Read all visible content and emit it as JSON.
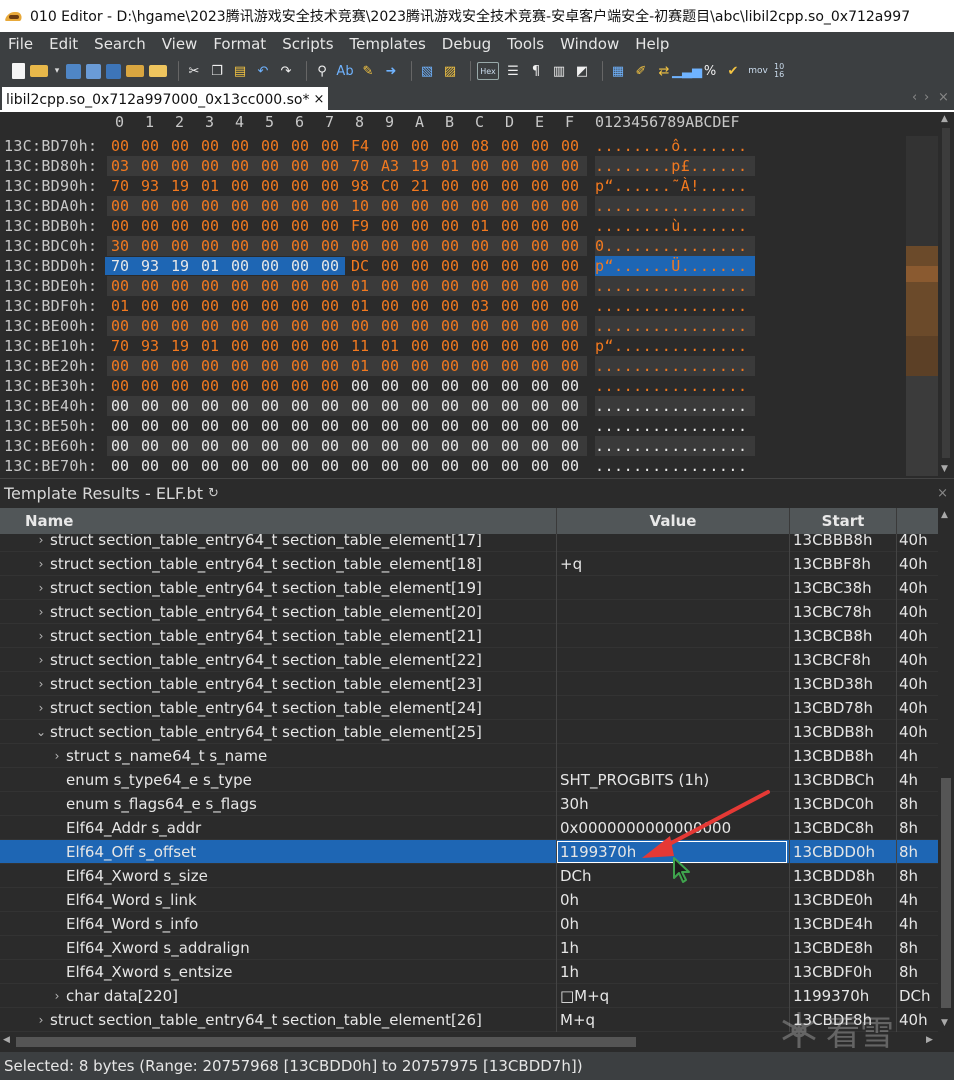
{
  "window": {
    "title": "010 Editor - D:\\hgame\\2023腾讯游戏安全技术竞赛\\2023腾讯游戏安全技术竞赛-安卓客户端安全-初赛题目\\abc\\libil2cpp.so_0x712a997"
  },
  "menu": [
    "File",
    "Edit",
    "Search",
    "View",
    "Format",
    "Scripts",
    "Templates",
    "Debug",
    "Tools",
    "Window",
    "Help"
  ],
  "toolbar": {
    "icons": [
      "new-file-icon",
      "open-folder-icon",
      "save-icon",
      "save-as-icon",
      "save-all-icon",
      "close-icon",
      "open-all-icon",
      "cut-icon",
      "copy-icon",
      "paste-icon",
      "undo-icon",
      "redo-icon",
      "find-icon",
      "replace-icon",
      "find-in-files-icon",
      "goto-icon",
      "compare-icon",
      "script-icon",
      "hex-mode-icon",
      "columns-icon",
      "paragraph-icon",
      "list-icon",
      "highlight-icon",
      "calculator-icon",
      "bookmark-icon",
      "swap-icon",
      "histogram-icon",
      "percent-icon",
      "check-icon",
      "mov-icon",
      "base-icon"
    ],
    "hex_label": "Hex",
    "mov_label": "mov",
    "base_label": "10 16"
  },
  "tab": {
    "label": "libil2cpp.so_0x712a997000_0x13cc000.so*",
    "close": "×",
    "nav_left": "‹",
    "nav_right": "›",
    "nav_close": "×"
  },
  "hex": {
    "column_headers": [
      "0",
      "1",
      "2",
      "3",
      "4",
      "5",
      "6",
      "7",
      "8",
      "9",
      "A",
      "B",
      "C",
      "D",
      "E",
      "F"
    ],
    "ascii_header": "0123456789ABCDEF",
    "rows": [
      {
        "addr": "13C:BD70h:",
        "bytes": [
          "00",
          "00",
          "00",
          "00",
          "00",
          "00",
          "00",
          "00",
          "F4",
          "00",
          "00",
          "00",
          "08",
          "00",
          "00",
          "00"
        ],
        "ascii": "........ô.......",
        "color_until": 16
      },
      {
        "addr": "13C:BD80h:",
        "bytes": [
          "03",
          "00",
          "00",
          "00",
          "00",
          "00",
          "00",
          "00",
          "70",
          "A3",
          "19",
          "01",
          "00",
          "00",
          "00",
          "00"
        ],
        "ascii": "........p£......",
        "color_until": 16
      },
      {
        "addr": "13C:BD90h:",
        "bytes": [
          "70",
          "93",
          "19",
          "01",
          "00",
          "00",
          "00",
          "00",
          "98",
          "C0",
          "21",
          "00",
          "00",
          "00",
          "00",
          "00"
        ],
        "ascii": "p“......˜À!.....",
        "color_until": 16
      },
      {
        "addr": "13C:BDA0h:",
        "bytes": [
          "00",
          "00",
          "00",
          "00",
          "00",
          "00",
          "00",
          "00",
          "10",
          "00",
          "00",
          "00",
          "00",
          "00",
          "00",
          "00"
        ],
        "ascii": "................",
        "color_until": 16
      },
      {
        "addr": "13C:BDB0h:",
        "bytes": [
          "00",
          "00",
          "00",
          "00",
          "00",
          "00",
          "00",
          "00",
          "F9",
          "00",
          "00",
          "00",
          "01",
          "00",
          "00",
          "00"
        ],
        "ascii": "........ù.......",
        "color_until": 16
      },
      {
        "addr": "13C:BDC0h:",
        "bytes": [
          "30",
          "00",
          "00",
          "00",
          "00",
          "00",
          "00",
          "00",
          "00",
          "00",
          "00",
          "00",
          "00",
          "00",
          "00",
          "00"
        ],
        "ascii": "0...............",
        "color_until": 16
      },
      {
        "addr": "13C:BDD0h:",
        "bytes": [
          "70",
          "93",
          "19",
          "01",
          "00",
          "00",
          "00",
          "00",
          "DC",
          "00",
          "00",
          "00",
          "00",
          "00",
          "00",
          "00"
        ],
        "ascii": "p“......Ü.......",
        "color_until": 16,
        "selected": true
      },
      {
        "addr": "13C:BDE0h:",
        "bytes": [
          "00",
          "00",
          "00",
          "00",
          "00",
          "00",
          "00",
          "00",
          "01",
          "00",
          "00",
          "00",
          "00",
          "00",
          "00",
          "00"
        ],
        "ascii": "................",
        "color_until": 16
      },
      {
        "addr": "13C:BDF0h:",
        "bytes": [
          "01",
          "00",
          "00",
          "00",
          "00",
          "00",
          "00",
          "00",
          "01",
          "00",
          "00",
          "00",
          "03",
          "00",
          "00",
          "00"
        ],
        "ascii": "................",
        "color_until": 16
      },
      {
        "addr": "13C:BE00h:",
        "bytes": [
          "00",
          "00",
          "00",
          "00",
          "00",
          "00",
          "00",
          "00",
          "00",
          "00",
          "00",
          "00",
          "00",
          "00",
          "00",
          "00"
        ],
        "ascii": "................",
        "color_until": 16
      },
      {
        "addr": "13C:BE10h:",
        "bytes": [
          "70",
          "93",
          "19",
          "01",
          "00",
          "00",
          "00",
          "00",
          "11",
          "01",
          "00",
          "00",
          "00",
          "00",
          "00",
          "00"
        ],
        "ascii": "p“..............",
        "color_until": 16
      },
      {
        "addr": "13C:BE20h:",
        "bytes": [
          "00",
          "00",
          "00",
          "00",
          "00",
          "00",
          "00",
          "00",
          "01",
          "00",
          "00",
          "00",
          "00",
          "00",
          "00",
          "00"
        ],
        "ascii": "................",
        "color_until": 16
      },
      {
        "addr": "13C:BE30h:",
        "bytes": [
          "00",
          "00",
          "00",
          "00",
          "00",
          "00",
          "00",
          "00",
          "00",
          "00",
          "00",
          "00",
          "00",
          "00",
          "00",
          "00"
        ],
        "ascii": "................",
        "color_until": 8
      },
      {
        "addr": "13C:BE40h:",
        "bytes": [
          "00",
          "00",
          "00",
          "00",
          "00",
          "00",
          "00",
          "00",
          "00",
          "00",
          "00",
          "00",
          "00",
          "00",
          "00",
          "00"
        ],
        "ascii": "................",
        "color_until": 0
      },
      {
        "addr": "13C:BE50h:",
        "bytes": [
          "00",
          "00",
          "00",
          "00",
          "00",
          "00",
          "00",
          "00",
          "00",
          "00",
          "00",
          "00",
          "00",
          "00",
          "00",
          "00"
        ],
        "ascii": "................",
        "color_until": 0
      },
      {
        "addr": "13C:BE60h:",
        "bytes": [
          "00",
          "00",
          "00",
          "00",
          "00",
          "00",
          "00",
          "00",
          "00",
          "00",
          "00",
          "00",
          "00",
          "00",
          "00",
          "00"
        ],
        "ascii": "................",
        "color_until": 0
      },
      {
        "addr": "13C:BE70h:",
        "bytes": [
          "00",
          "00",
          "00",
          "00",
          "00",
          "00",
          "00",
          "00",
          "00",
          "00",
          "00",
          "00",
          "00",
          "00",
          "00",
          "00"
        ],
        "ascii": "................",
        "color_until": 0
      }
    ]
  },
  "template_panel": {
    "title": "Template Results - ELF.bt",
    "refresh_icon": "↻",
    "columns": {
      "name": "Name",
      "value": "Value",
      "start": "Start"
    },
    "rows": [
      {
        "indent": 1,
        "chevron": "›",
        "name": "struct section_table_entry64_t section_table_element[17]",
        "value": "",
        "start": "13CBBB8h",
        "size": "40h"
      },
      {
        "indent": 1,
        "chevron": "›",
        "name": "struct section_table_entry64_t section_table_element[18]",
        "value": "+q",
        "start": "13CBBF8h",
        "size": "40h"
      },
      {
        "indent": 1,
        "chevron": "›",
        "name": "struct section_table_entry64_t section_table_element[19]",
        "value": "",
        "start": "13CBC38h",
        "size": "40h"
      },
      {
        "indent": 1,
        "chevron": "›",
        "name": "struct section_table_entry64_t section_table_element[20]",
        "value": "",
        "start": "13CBC78h",
        "size": "40h"
      },
      {
        "indent": 1,
        "chevron": "›",
        "name": "struct section_table_entry64_t section_table_element[21]",
        "value": "",
        "start": "13CBCB8h",
        "size": "40h"
      },
      {
        "indent": 1,
        "chevron": "›",
        "name": "struct section_table_entry64_t section_table_element[22]",
        "value": "",
        "start": "13CBCF8h",
        "size": "40h"
      },
      {
        "indent": 1,
        "chevron": "›",
        "name": "struct section_table_entry64_t section_table_element[23]",
        "value": "",
        "start": "13CBD38h",
        "size": "40h"
      },
      {
        "indent": 1,
        "chevron": "›",
        "name": "struct section_table_entry64_t section_table_element[24]",
        "value": "",
        "start": "13CBD78h",
        "size": "40h"
      },
      {
        "indent": 1,
        "chevron": "⌄",
        "name": "struct section_table_entry64_t section_table_element[25]",
        "value": "",
        "start": "13CBDB8h",
        "size": "40h"
      },
      {
        "indent": 2,
        "chevron": "›",
        "name": "struct s_name64_t s_name",
        "value": "",
        "start": "13CBDB8h",
        "size": "4h"
      },
      {
        "indent": 2,
        "chevron": "",
        "name": "enum s_type64_e s_type",
        "value": "SHT_PROGBITS (1h)",
        "start": "13CBDBCh",
        "size": "4h"
      },
      {
        "indent": 2,
        "chevron": "",
        "name": "enum s_flags64_e s_flags",
        "value": "30h",
        "start": "13CBDC0h",
        "size": "8h"
      },
      {
        "indent": 2,
        "chevron": "",
        "name": "Elf64_Addr s_addr",
        "value": "0x0000000000000000",
        "start": "13CBDC8h",
        "size": "8h"
      },
      {
        "indent": 2,
        "chevron": "",
        "name": "Elf64_Off s_offset",
        "value": "1199370h",
        "start": "13CBDD0h",
        "size": "8h",
        "selected": true
      },
      {
        "indent": 2,
        "chevron": "",
        "name": "Elf64_Xword s_size",
        "value": "DCh",
        "start": "13CBDD8h",
        "size": "8h"
      },
      {
        "indent": 2,
        "chevron": "",
        "name": "Elf64_Word s_link",
        "value": "0h",
        "start": "13CBDE0h",
        "size": "4h"
      },
      {
        "indent": 2,
        "chevron": "",
        "name": "Elf64_Word s_info",
        "value": "0h",
        "start": "13CBDE4h",
        "size": "4h"
      },
      {
        "indent": 2,
        "chevron": "",
        "name": "Elf64_Xword s_addralign",
        "value": "1h",
        "start": "13CBDE8h",
        "size": "8h"
      },
      {
        "indent": 2,
        "chevron": "",
        "name": "Elf64_Xword s_entsize",
        "value": "1h",
        "start": "13CBDF0h",
        "size": "8h"
      },
      {
        "indent": 2,
        "chevron": "›",
        "name": "char data[220]",
        "value": "□M+q",
        "start": "1199370h",
        "size": "DCh"
      },
      {
        "indent": 1,
        "chevron": "›",
        "name": "struct section_table_entry64_t section_table_element[26]",
        "value": "M+q",
        "start": "13CBDF8h",
        "size": "40h"
      }
    ]
  },
  "status": {
    "text": "Selected: 8 bytes (Range: 20757968 [13CBDD0h] to 20757975 [13CBDD7h])"
  },
  "watermark": {
    "text": "看雪"
  },
  "colors": {
    "highlight_byte": "#f2791f",
    "selection": "#1e66b4",
    "annotation_arrow": "#e53935",
    "cursor": "#3fa34d"
  }
}
